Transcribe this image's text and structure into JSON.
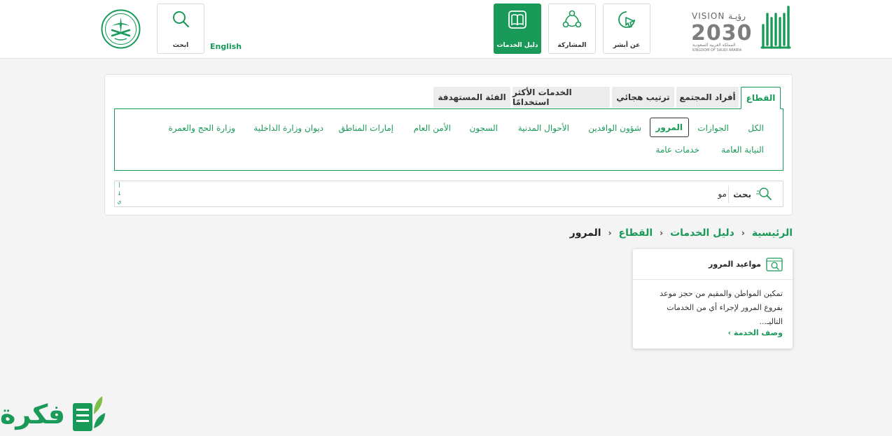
{
  "header": {
    "nav": [
      {
        "label": "عن أبشر",
        "icon": "cursor-click-icon"
      },
      {
        "label": "المشاركة",
        "icon": "share-network-icon"
      },
      {
        "label": "دليل الخدمات",
        "icon": "book-icon",
        "active": true
      }
    ],
    "search_label": "ابحث",
    "language_link": "English",
    "vision": {
      "title": "VISION رؤيـة",
      "year": "2030",
      "line1": "المملكة العربية السعودية",
      "line2": "KINGDOM OF SAUDI ARABIA"
    },
    "brand_color": "#1a9a59"
  },
  "tabs": [
    {
      "label": "القطاع",
      "active": true
    },
    {
      "label": "أفراد المجتمع"
    },
    {
      "label": "ترتيب هجائي"
    },
    {
      "label": "الخدمات الأكثر استخدامًا"
    },
    {
      "label": "الفئة المستهدفة"
    }
  ],
  "filters": {
    "row1": [
      "الكل",
      "الجوازات",
      "المرور",
      "شؤون الوافدين",
      "الأحوال المدنية",
      "السجون",
      "الأمن العام",
      "إمارات المناطق",
      "ديوان وزارة الداخلية",
      "وزارة الحج والعمرة"
    ],
    "row2": [
      "النيابة العامة",
      "خدمات عامة"
    ],
    "selected": "المرور"
  },
  "search": {
    "label": "بحث",
    "value": "مو",
    "alpha_index": [
      "أ",
      "↓",
      "ي"
    ]
  },
  "breadcrumb": {
    "home": "الرئيسية",
    "guide": "دليل الخدمات",
    "sector": "القطاع",
    "current": "المرور",
    "separator": "‹"
  },
  "service_card": {
    "title": "مواعيد المرور",
    "description": "تمكين المواطن والمقيم من حجز موعد بفروع المرور لإجراء أي من الخدمات التاليـ...",
    "link": "وصف الخدمة ›"
  },
  "watermark": {
    "text": "فكرة"
  }
}
